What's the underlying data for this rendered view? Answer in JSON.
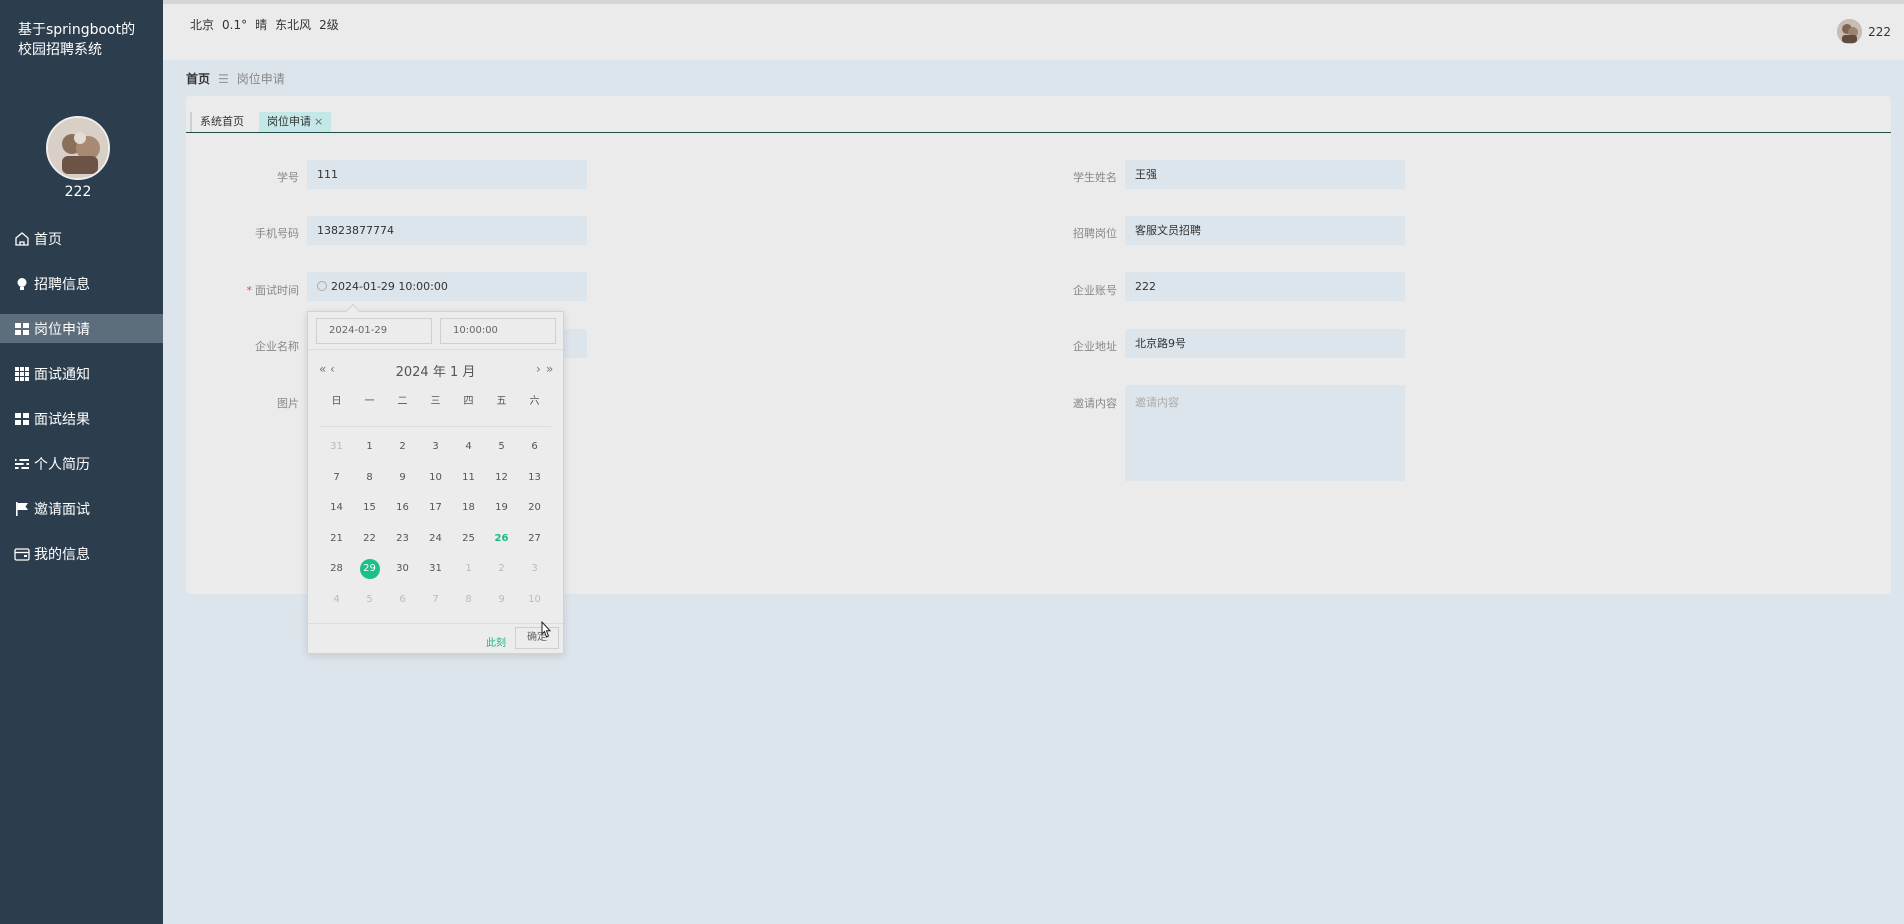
{
  "app": {
    "title": "基于springboot的校园招聘系统",
    "user_name": "222"
  },
  "weather": {
    "city": "北京",
    "temp": "0.1°",
    "condition": "晴",
    "wind": "东北风",
    "level": "2级"
  },
  "top_user": {
    "name": "222"
  },
  "menu": [
    {
      "label": "首页",
      "icon": "home-icon",
      "active": false
    },
    {
      "label": "招聘信息",
      "icon": "bulb-icon",
      "active": false
    },
    {
      "label": "岗位申请",
      "icon": "grid-icon",
      "active": true
    },
    {
      "label": "面试通知",
      "icon": "apps-icon",
      "active": false
    },
    {
      "label": "面试结果",
      "icon": "grid-icon",
      "active": false
    },
    {
      "label": "个人简历",
      "icon": "list-icon",
      "active": false
    },
    {
      "label": "邀请面试",
      "icon": "flag-icon",
      "active": false
    },
    {
      "label": "我的信息",
      "icon": "wallet-icon",
      "active": false
    }
  ],
  "breadcrumb": {
    "home": "首页",
    "separator": "☰",
    "current": "岗位申请"
  },
  "tabs": [
    {
      "label": "系统首页"
    },
    {
      "label": "岗位申请",
      "close": "×"
    }
  ],
  "form": {
    "student_id": {
      "label": "学号",
      "value": "111"
    },
    "student_name": {
      "label": "学生姓名",
      "value": "王强"
    },
    "phone": {
      "label": "手机号码",
      "value": "13823877774"
    },
    "position": {
      "label": "招聘岗位",
      "value": "客服文员招聘"
    },
    "interview_time": {
      "label": "面试时间",
      "required": "*",
      "value": "2024-01-29 10:00:00"
    },
    "company_account": {
      "label": "企业账号",
      "value": "222"
    },
    "company_name": {
      "label": "企业名称"
    },
    "company_address": {
      "label": "企业地址",
      "value": "北京路9号"
    },
    "image": {
      "label": "图片"
    },
    "invite": {
      "label": "邀请内容",
      "placeholder": "邀请内容"
    }
  },
  "picker": {
    "date_value": "2024-01-29",
    "time_value": "10:00:00",
    "title": "2024 年  1 月",
    "prev_year": "«",
    "prev_month": "‹",
    "next_month": "›",
    "next_year": "»",
    "weekdays": [
      "日",
      "一",
      "二",
      "三",
      "四",
      "五",
      "六"
    ],
    "days": [
      [
        "31",
        "1",
        "2",
        "3",
        "4",
        "5",
        "6"
      ],
      [
        "7",
        "8",
        "9",
        "10",
        "11",
        "12",
        "13"
      ],
      [
        "14",
        "15",
        "16",
        "17",
        "18",
        "19",
        "20"
      ],
      [
        "21",
        "22",
        "23",
        "24",
        "25",
        "26",
        "27"
      ],
      [
        "28",
        "29",
        "30",
        "31",
        "1",
        "2",
        "3"
      ],
      [
        "4",
        "5",
        "6",
        "7",
        "8",
        "9",
        "10"
      ]
    ],
    "today": "26",
    "selected": "29",
    "now_label": "此刻",
    "ok_label": "确定"
  },
  "colors": {
    "sidebar": "#2c3e4e",
    "accent": "#1bc088",
    "tab_active": "#c4e8e8"
  }
}
